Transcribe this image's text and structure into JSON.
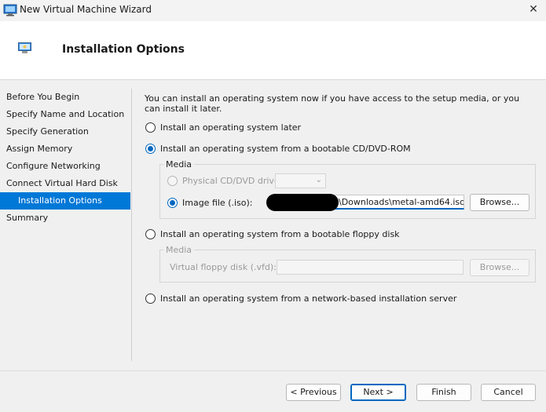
{
  "window": {
    "title": "New Virtual Machine Wizard",
    "close_glyph": "✕"
  },
  "header": {
    "title": "Installation Options"
  },
  "sidebar": {
    "items": [
      {
        "label": "Before You Begin"
      },
      {
        "label": "Specify Name and Location"
      },
      {
        "label": "Specify Generation"
      },
      {
        "label": "Assign Memory"
      },
      {
        "label": "Configure Networking"
      },
      {
        "label": "Connect Virtual Hard Disk"
      },
      {
        "label": "Installation Options",
        "active": true
      },
      {
        "label": "Summary"
      }
    ]
  },
  "main": {
    "intro": "You can install an operating system now if you have access to the setup media, or you can install it later.",
    "option_later": "Install an operating system later",
    "option_cd": "Install an operating system from a bootable CD/DVD-ROM",
    "media_group": {
      "legend": "Media",
      "physical_label": "Physical CD/DVD drive:",
      "physical_value": "",
      "image_label": "Image file (.iso):",
      "image_value": "\\Downloads\\metal-amd64.iso",
      "browse": "Browse..."
    },
    "option_floppy": "Install an operating system from a bootable floppy disk",
    "floppy_group": {
      "legend": "Media",
      "floppy_label": "Virtual floppy disk (.vfd):",
      "floppy_value": "",
      "browse": "Browse..."
    },
    "option_network": "Install an operating system from a network-based installation server"
  },
  "footer": {
    "previous": "< Previous",
    "next": "Next >",
    "finish": "Finish",
    "cancel": "Cancel"
  },
  "colors": {
    "accent": "#0078d7",
    "radio_accent": "#0067c0"
  }
}
